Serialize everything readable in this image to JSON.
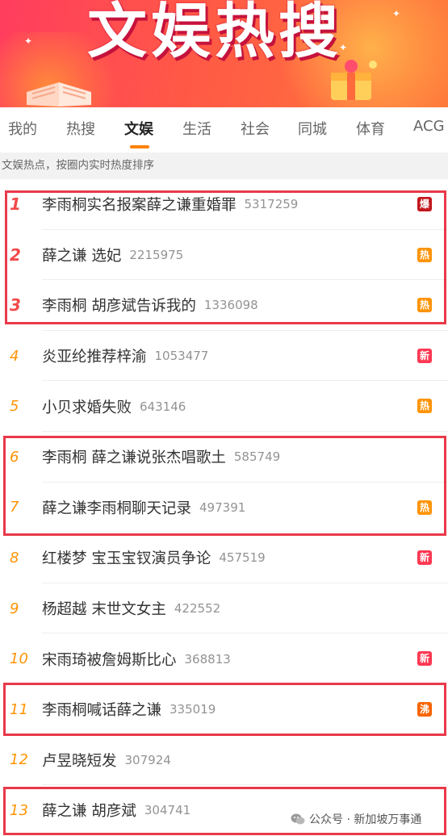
{
  "banner": {
    "title": "文娱热搜"
  },
  "tabs": [
    {
      "label": "我的"
    },
    {
      "label": "热搜"
    },
    {
      "label": "文娱",
      "active": true
    },
    {
      "label": "生活"
    },
    {
      "label": "社会"
    },
    {
      "label": "同城"
    },
    {
      "label": "体育"
    },
    {
      "label": "ACG"
    }
  ],
  "subtitle": "文娱热点，按圈内实时热度排序",
  "list": [
    {
      "rank": "1",
      "topic": "李雨桐实名报案薛之谦重婚罪",
      "heat": "5317259",
      "badge": "爆",
      "badge_color": "#c2181d"
    },
    {
      "rank": "2",
      "topic": "薛之谦 选妃",
      "heat": "2215975",
      "badge": "热",
      "badge_color": "#ff9406"
    },
    {
      "rank": "3",
      "topic": "李雨桐 胡彦斌告诉我的",
      "heat": "1336098",
      "badge": "热",
      "badge_color": "#ff9406"
    },
    {
      "rank": "4",
      "topic": "炎亚纶推荐梓渝",
      "heat": "1053477",
      "badge": "新",
      "badge_color": "#ff3852"
    },
    {
      "rank": "5",
      "topic": "小贝求婚失败",
      "heat": "643146",
      "badge": "热",
      "badge_color": "#ff9406"
    },
    {
      "rank": "6",
      "topic": "李雨桐 薛之谦说张杰唱歌土",
      "heat": "585749",
      "badge": "",
      "badge_color": ""
    },
    {
      "rank": "7",
      "topic": "薛之谦李雨桐聊天记录",
      "heat": "497391",
      "badge": "热",
      "badge_color": "#ff9406"
    },
    {
      "rank": "8",
      "topic": "红楼梦 宝玉宝钗演员争论",
      "heat": "457519",
      "badge": "新",
      "badge_color": "#ff3852"
    },
    {
      "rank": "9",
      "topic": "杨超越 末世文女主",
      "heat": "422552",
      "badge": "",
      "badge_color": ""
    },
    {
      "rank": "10",
      "topic": "宋雨琦被詹姆斯比心",
      "heat": "368813",
      "badge": "新",
      "badge_color": "#ff3852"
    },
    {
      "rank": "11",
      "topic": "李雨桐喊话薛之谦",
      "heat": "335019",
      "badge": "沸",
      "badge_color": "#f86400"
    },
    {
      "rank": "12",
      "topic": "卢昱晓短发",
      "heat": "307924",
      "badge": "",
      "badge_color": ""
    },
    {
      "rank": "13",
      "topic": "薛之谦 胡彦斌",
      "heat": "304741",
      "badge": "",
      "badge_color": ""
    }
  ],
  "watermark": {
    "text": "公众号 · 新加坡万事通"
  },
  "colors": {
    "accent": "#ff8200",
    "highlight_box": "#e9394a",
    "rank_top": "#f24a4a",
    "rank": "#ff9406"
  }
}
